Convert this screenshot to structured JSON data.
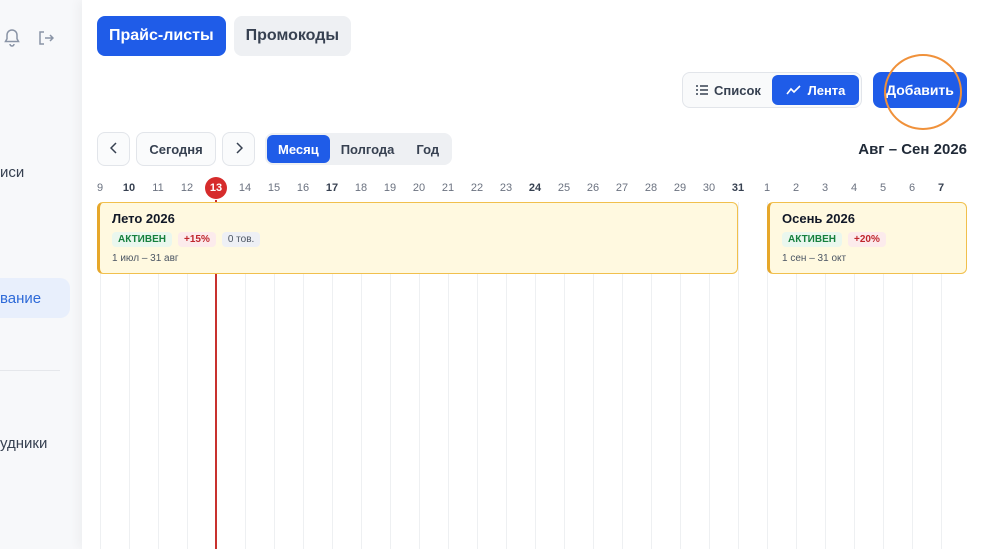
{
  "sidebar": {
    "items": [
      {
        "label": "иси"
      },
      {
        "label": "вание"
      },
      {
        "label": "удники"
      }
    ]
  },
  "tabs": [
    {
      "label": "Прайс-листы",
      "active": true
    },
    {
      "label": "Промокоды",
      "active": false
    }
  ],
  "view_toggle": {
    "list_label": "Список",
    "feed_label": "Лента",
    "active": "feed"
  },
  "add_button": {
    "label": "Добавить"
  },
  "toolbar": {
    "today_label": "Сегодня",
    "ranges": [
      {
        "label": "Месяц",
        "active": true
      },
      {
        "label": "Полгода",
        "active": false
      },
      {
        "label": "Год",
        "active": false
      }
    ],
    "period": "Авг – Сен 2026"
  },
  "timeline": {
    "days": [
      "9",
      "10",
      "11",
      "12",
      "13",
      "14",
      "15",
      "16",
      "17",
      "18",
      "19",
      "20",
      "21",
      "22",
      "23",
      "24",
      "25",
      "26",
      "27",
      "28",
      "29",
      "30",
      "31",
      "1",
      "2",
      "3",
      "4",
      "5",
      "6",
      "7"
    ],
    "bold_days": [
      "10",
      "17",
      "24",
      "31",
      "7"
    ],
    "today": "13",
    "price_lists": [
      {
        "title": "Лето 2026",
        "status": "АКТИВЕН",
        "percent": "+15%",
        "goods": "0 тов.",
        "dates": "1 июл – 31 авг"
      },
      {
        "title": "Осень 2026",
        "status": "АКТИВЕН",
        "percent": "+20%",
        "goods": "",
        "dates": "1 сен – 31 окт"
      }
    ]
  },
  "colors": {
    "accent": "#1f5ce8",
    "today_marker": "#d62c2c",
    "bar_bg": "#fff9e0",
    "bar_border": "#f1c04d",
    "highlight": "#f0913a"
  }
}
